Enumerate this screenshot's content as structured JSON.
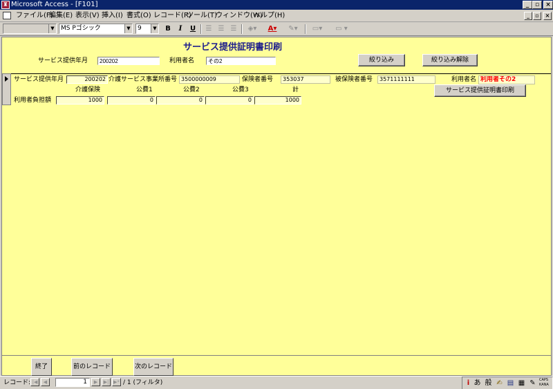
{
  "window": {
    "title": "Microsoft Access - [F101]",
    "app_icon": "access-key-icon",
    "controls": [
      "_",
      "▫",
      "×"
    ]
  },
  "menubar": {
    "items": [
      "ファイル(F)",
      "編集(E)",
      "表示(V)",
      "挿入(I)",
      "書式(O)",
      "レコード(R)",
      "ツール(T)",
      "ウィンドウ(W)",
      "ヘルプ(H)"
    ]
  },
  "toolbar": {
    "object_combo": "",
    "font_combo": "MS Pゴシック",
    "size_combo": "9",
    "bold": "B",
    "italic": "I",
    "underline": "U"
  },
  "form": {
    "title": "サービス提供証明書印刷",
    "filter": {
      "month_label": "サービス提供年月",
      "month_value": "200202",
      "user_label": "利用者名",
      "user_value": "その2",
      "filter_button": "絞り込み",
      "clear_button": "絞り込み解除"
    },
    "record": {
      "month_label": "サービス提供年月",
      "month_value": "200202",
      "provider_label": "介護サービス事業所番号",
      "provider_value": "3500000009",
      "insurer_label": "保険者番号",
      "insurer_value": "353037",
      "insured_label": "被保険者番号",
      "insured_value": "3571111111",
      "user_label": "利用者名",
      "user_value": "利用者その2",
      "print_button": "サービス提供証明書印刷",
      "burden_label": "利用者負担額",
      "columns": [
        "介護保険",
        "公費1",
        "公費2",
        "公費3",
        "計"
      ],
      "values": [
        "1000",
        "0",
        "0",
        "0",
        "1000"
      ]
    },
    "footer": {
      "exit_button": "終了",
      "prev_button": "前のレコード",
      "next_button": "次のレコード"
    }
  },
  "navigation": {
    "record_label": "レコード:",
    "current_record": "1",
    "total_text": "/ 1 (フィルタ)"
  },
  "ime": {
    "mode": "あ",
    "conversion": "般",
    "caps": "CAPS",
    "kana": "KANA"
  }
}
